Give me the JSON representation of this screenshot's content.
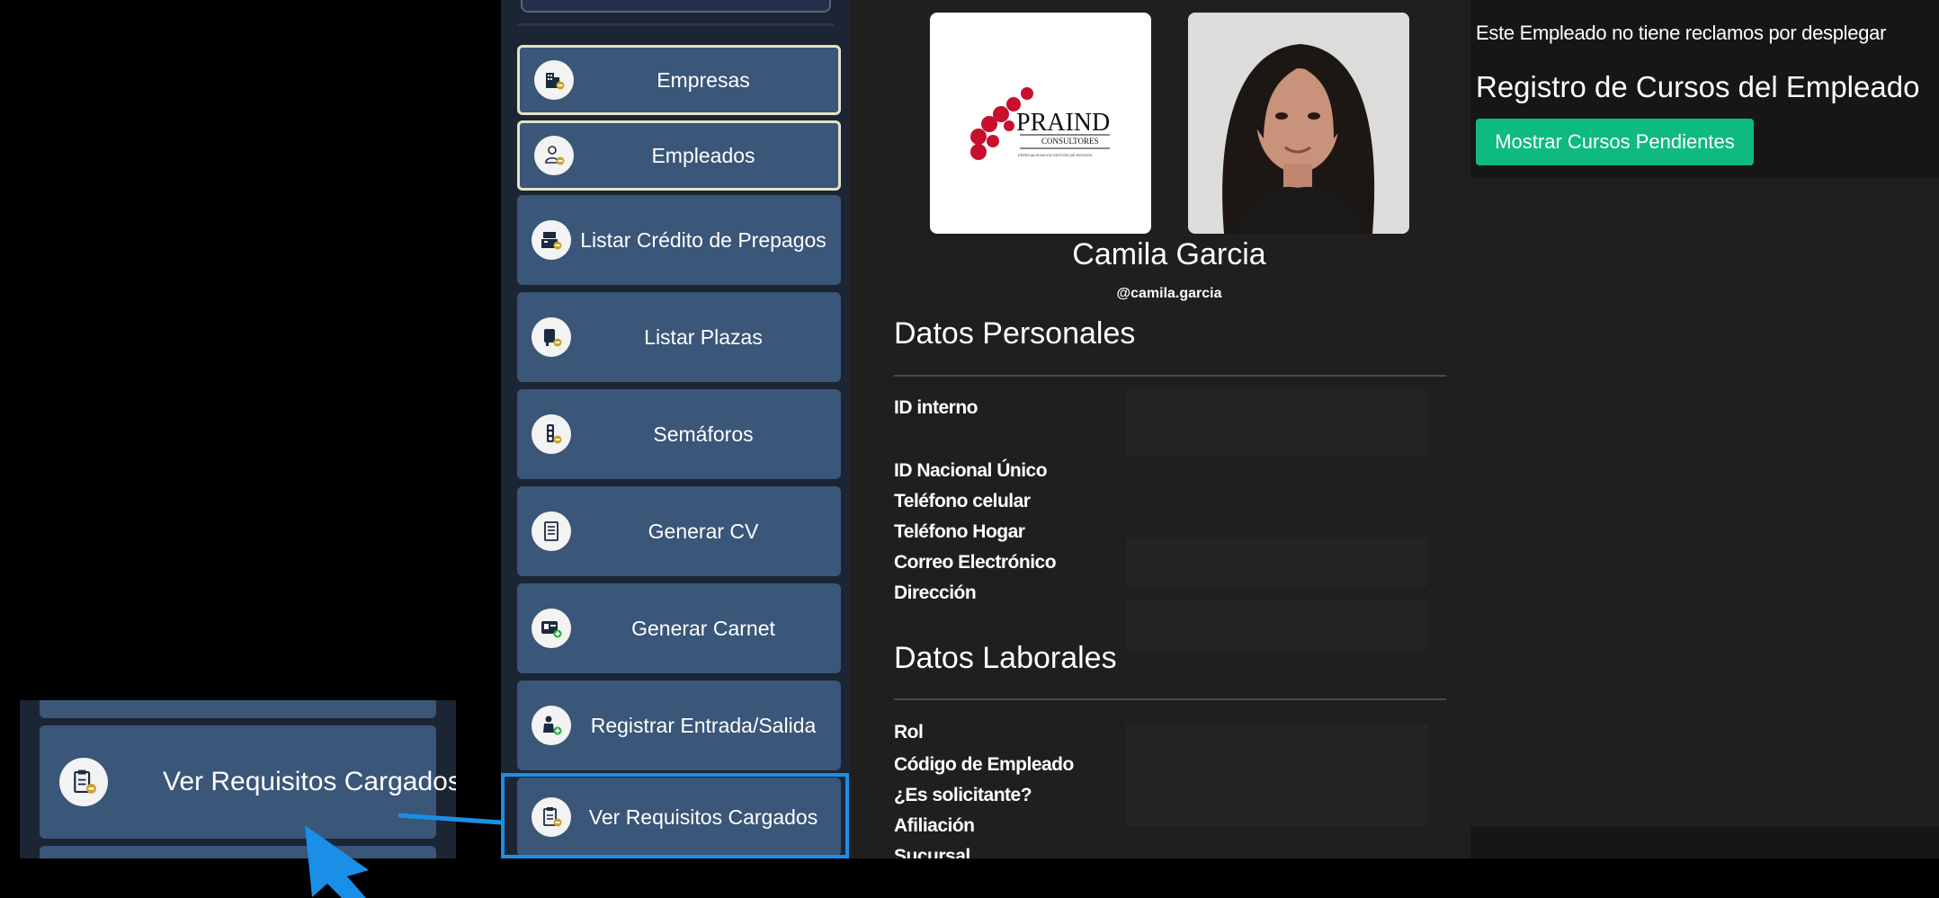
{
  "sidebar": {
    "items": [
      {
        "label": "Empresas",
        "icon": "building-icon",
        "active": true
      },
      {
        "label": "Empleados",
        "icon": "employee-icon",
        "active": true
      },
      {
        "label": "Listar Crédito de Prepagos",
        "icon": "cash-register-icon",
        "active": false
      },
      {
        "label": "Listar Plazas",
        "icon": "seat-icon",
        "active": false
      },
      {
        "label": "Semáforos",
        "icon": "traffic-light-icon",
        "active": false
      },
      {
        "label": "Generar CV",
        "icon": "document-icon",
        "active": false
      },
      {
        "label": "Generar Carnet",
        "icon": "id-card-icon",
        "active": false
      },
      {
        "label": "Registrar Entrada/Salida",
        "icon": "person-clock-icon",
        "active": false
      },
      {
        "label": "Ver Requisitos Cargados",
        "icon": "clipboard-badge-icon",
        "active": false
      }
    ]
  },
  "profile": {
    "logo_main": "PRAIND",
    "logo_sub": "CONSULTORES",
    "logo_tagline": "ESPECIALISTAS EN GESTIÓN DE RIESGOS",
    "name": "Camila Garcia",
    "username": "@camila.garcia"
  },
  "personal": {
    "title": "Datos Personales",
    "labels": [
      "ID interno",
      "ID Nacional Único",
      "Teléfono celular",
      "Teléfono Hogar",
      "Correo Electrónico",
      "Dirección"
    ]
  },
  "laboral": {
    "title": "Datos Laborales",
    "labels": [
      "Rol",
      "Código de Empleado",
      "¿Es solicitante?",
      "Afiliación",
      "Sucursal"
    ]
  },
  "right": {
    "note": "Este Empleado no tiene reclamos por desplegar",
    "title": "Registro de Cursos del Empleado",
    "button": "Mostrar Cursos Pendientes"
  },
  "zoom": {
    "label": "Ver Requisitos Cargados"
  },
  "colors": {
    "sidebar_item": "#3a5678",
    "active_border": "#e3e3c6",
    "highlight": "#1a8fe8",
    "button_green": "#0fba7f"
  }
}
